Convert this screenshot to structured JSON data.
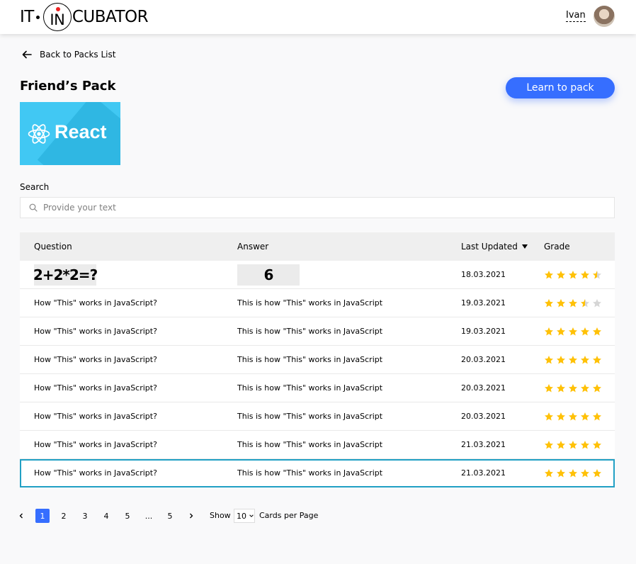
{
  "header": {
    "logo_left": "IT",
    "logo_in": "IN",
    "logo_right": "CUBATOR",
    "user_name": "Ivan"
  },
  "back_link": {
    "label": "Back to Packs List",
    "icon": "arrow-left-icon"
  },
  "pack": {
    "title": "Friend’s Pack",
    "cover_text": "React",
    "learn_button": "Learn to pack"
  },
  "search": {
    "label": "Search",
    "placeholder": "Provide your text",
    "value": "",
    "icon": "search-icon"
  },
  "table": {
    "columns": [
      "Question",
      "Answer",
      "Last Updated",
      "Grade"
    ],
    "sorted_column": "Last Updated",
    "sort_direction": "desc",
    "rows": [
      {
        "question": "2+2*2=?",
        "answer": "6",
        "date": "18.03.2021",
        "grade": 4.5,
        "image": true
      },
      {
        "question": "How \"This\" works in JavaScript?",
        "answer": "This is how \"This\" works in JavaScript",
        "date": "19.03.2021",
        "grade": 3.5
      },
      {
        "question": "How \"This\" works in JavaScript?",
        "answer": "This is how \"This\" works in JavaScript",
        "date": "19.03.2021",
        "grade": 5
      },
      {
        "question": "How \"This\" works in JavaScript?",
        "answer": "This is how \"This\" works in JavaScript",
        "date": "20.03.2021",
        "grade": 5
      },
      {
        "question": "How \"This\" works in JavaScript?",
        "answer": "This is how \"This\" works in JavaScript",
        "date": "20.03.2021",
        "grade": 5
      },
      {
        "question": "How \"This\" works in JavaScript?",
        "answer": "This is how \"This\" works in JavaScript",
        "date": "20.03.2021",
        "grade": 5
      },
      {
        "question": "How \"This\" works in JavaScript?",
        "answer": "This is how \"This\" works in JavaScript",
        "date": "21.03.2021",
        "grade": 5
      },
      {
        "question": "How \"This\" works in JavaScript?",
        "answer": "This is how \"This\" works in JavaScript",
        "date": "21.03.2021",
        "grade": 5,
        "selected": true
      }
    ]
  },
  "colors": {
    "accent": "#366eff",
    "star": "#ffc107",
    "star_empty": "#d6d6d6",
    "selected_border": "#21a0c4"
  },
  "pagination": {
    "pages": [
      "1",
      "2",
      "3",
      "4",
      "5",
      "...",
      "5"
    ],
    "current": "1",
    "show_label": "Show",
    "per_page": "10",
    "per_page_label": "Cards per Page"
  }
}
